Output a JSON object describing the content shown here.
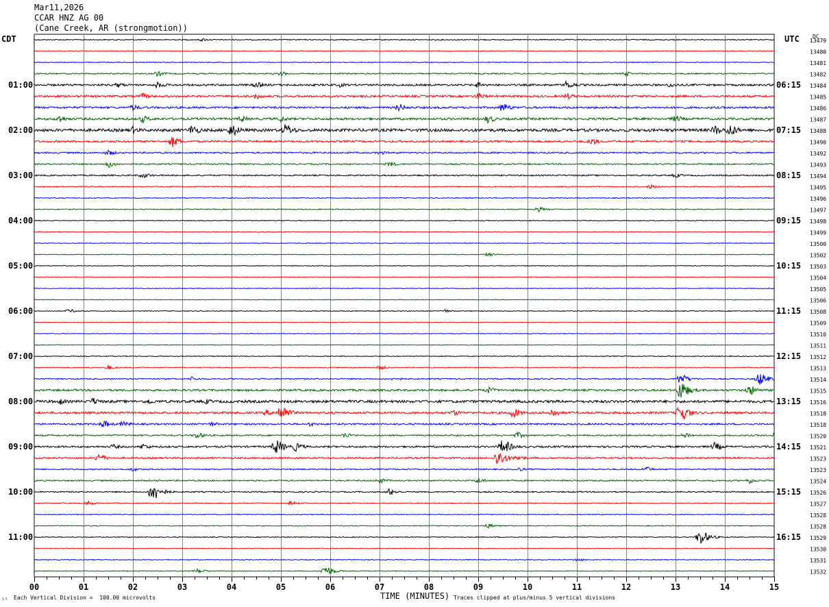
{
  "header": {
    "date": "Mar11,2026",
    "station": "CCAR HNZ AG 00",
    "location": "(Cane Creek, AR (strongmotion))"
  },
  "left_zone": "CDT",
  "right_zone": "UTC",
  "right_col_header": "DC",
  "footer": {
    "scale_note": "Each Vertical Division =  100.00 microvolts",
    "clip_note": "Traces clipped at plus/minus 5 vertical divisions",
    "corner_mark": "¹⁵"
  },
  "chart_data": {
    "type": "line",
    "title": "",
    "xlabel": "TIME (MINUTES)",
    "ylabel": "",
    "xlim": [
      0,
      15
    ],
    "x_ticks": [
      "00",
      "01",
      "02",
      "03",
      "04",
      "05",
      "06",
      "07",
      "08",
      "09",
      "10",
      "11",
      "12",
      "13",
      "14",
      "15"
    ],
    "grid": true,
    "trace_colors": [
      "#000000",
      "#ff0000",
      "#0000ff",
      "#006400"
    ],
    "left_time_labels": [
      "01:00",
      "02:00",
      "03:00",
      "04:00",
      "05:00",
      "06:00",
      "07:00",
      "08:00",
      "09:00",
      "10:00",
      "11:00"
    ],
    "right_time_labels": [
      "06:15",
      "07:15",
      "08:15",
      "09:15",
      "10:15",
      "11:15",
      "12:15",
      "13:15",
      "14:15",
      "15:15",
      "16:15"
    ],
    "right_dc_values": [
      "13479",
      "13480",
      "13481",
      "13482",
      "13484",
      "13485",
      "13486",
      "13487",
      "13488",
      "13490",
      "13492",
      "13493",
      "13494",
      "13495",
      "13496",
      "13497",
      "13498",
      "13499",
      "13500",
      "13502",
      "13503",
      "13504",
      "13505",
      "13506",
      "13508",
      "13509",
      "13510",
      "13511",
      "13512",
      "13513",
      "13514",
      "13515",
      "13516",
      "13518",
      "13518",
      "13520",
      "13521",
      "13523",
      "13523",
      "13524",
      "13526",
      "13527",
      "13528",
      "13528",
      "13529",
      "13530",
      "13531",
      "13532"
    ],
    "series": [
      {
        "row": 0,
        "noise": 0.45,
        "events": [
          [
            3.4,
            0.7
          ]
        ]
      },
      {
        "row": 1,
        "noise": 0.35,
        "events": []
      },
      {
        "row": 2,
        "noise": 0.35,
        "events": []
      },
      {
        "row": 3,
        "noise": 0.55,
        "events": [
          [
            2.5,
            1.2
          ],
          [
            5.0,
            1.0
          ],
          [
            12.0,
            1.0
          ]
        ]
      },
      {
        "row": 4,
        "noise": 0.85,
        "events": [
          [
            1.7,
            1.2
          ],
          [
            2.5,
            1.5
          ],
          [
            4.5,
            1.4
          ],
          [
            6.2,
            1.0
          ],
          [
            9.0,
            1.4
          ],
          [
            10.8,
            2.0
          ],
          [
            12.9,
            1.2
          ]
        ]
      },
      {
        "row": 5,
        "noise": 0.95,
        "events": [
          [
            2.2,
            1.4
          ],
          [
            4.5,
            1.4
          ],
          [
            9.0,
            1.6
          ],
          [
            10.8,
            1.5
          ]
        ]
      },
      {
        "row": 6,
        "noise": 0.9,
        "events": [
          [
            2.0,
            1.4
          ],
          [
            7.4,
            1.8
          ],
          [
            9.5,
            2.2
          ]
        ]
      },
      {
        "row": 7,
        "noise": 1.0,
        "events": [
          [
            0.5,
            1.9
          ],
          [
            2.2,
            1.7
          ],
          [
            4.2,
            1.5
          ],
          [
            5.0,
            1.5
          ],
          [
            9.2,
            1.8
          ],
          [
            13.0,
            1.6
          ]
        ]
      },
      {
        "row": 8,
        "noise": 1.3,
        "events": [
          [
            2.0,
            1.7
          ],
          [
            3.2,
            2.5
          ],
          [
            4.0,
            3.0
          ],
          [
            5.1,
            3.0
          ],
          [
            13.8,
            2.3
          ],
          [
            14.1,
            3.0
          ]
        ]
      },
      {
        "row": 9,
        "noise": 0.9,
        "events": [
          [
            2.8,
            2.5
          ],
          [
            11.3,
            1.6
          ]
        ]
      },
      {
        "row": 10,
        "noise": 0.7,
        "events": [
          [
            1.5,
            1.3
          ],
          [
            7.0,
            1.0
          ]
        ]
      },
      {
        "row": 11,
        "noise": 0.6,
        "events": [
          [
            1.5,
            1.6
          ],
          [
            7.2,
            1.2
          ]
        ]
      },
      {
        "row": 12,
        "noise": 0.6,
        "events": [
          [
            2.2,
            1.3
          ],
          [
            13.0,
            1.0
          ]
        ]
      },
      {
        "row": 13,
        "noise": 0.45,
        "events": [
          [
            12.5,
            1.0
          ]
        ]
      },
      {
        "row": 14,
        "noise": 0.4,
        "events": []
      },
      {
        "row": 15,
        "noise": 0.4,
        "events": [
          [
            10.2,
            1.2
          ]
        ]
      },
      {
        "row": 16,
        "noise": 0.35,
        "events": []
      },
      {
        "row": 17,
        "noise": 0.3,
        "events": []
      },
      {
        "row": 18,
        "noise": 0.3,
        "events": []
      },
      {
        "row": 19,
        "noise": 0.3,
        "events": [
          [
            9.2,
            0.8
          ]
        ]
      },
      {
        "row": 20,
        "noise": 0.3,
        "events": []
      },
      {
        "row": 21,
        "noise": 0.3,
        "events": []
      },
      {
        "row": 22,
        "noise": 0.3,
        "events": []
      },
      {
        "row": 23,
        "noise": 0.3,
        "events": []
      },
      {
        "row": 24,
        "noise": 0.35,
        "events": [
          [
            0.7,
            0.9
          ],
          [
            8.3,
            0.8
          ]
        ]
      },
      {
        "row": 25,
        "noise": 0.3,
        "events": []
      },
      {
        "row": 26,
        "noise": 0.3,
        "events": []
      },
      {
        "row": 27,
        "noise": 0.3,
        "events": []
      },
      {
        "row": 28,
        "noise": 0.35,
        "events": []
      },
      {
        "row": 29,
        "noise": 0.4,
        "events": [
          [
            1.5,
            1.0
          ],
          [
            7.0,
            1.0
          ]
        ]
      },
      {
        "row": 30,
        "noise": 0.55,
        "events": [
          [
            3.2,
            1.0
          ],
          [
            7.3,
            1.0
          ],
          [
            13.1,
            2.5
          ],
          [
            14.7,
            3.0
          ]
        ]
      },
      {
        "row": 31,
        "noise": 0.9,
        "events": [
          [
            9.2,
            1.5
          ],
          [
            13.1,
            4.5
          ],
          [
            14.5,
            2.5
          ]
        ]
      },
      {
        "row": 32,
        "noise": 1.2,
        "events": [
          [
            0.5,
            1.6
          ],
          [
            1.2,
            1.7
          ],
          [
            2.3,
            1.5
          ],
          [
            3.5,
            1.2
          ]
        ]
      },
      {
        "row": 33,
        "noise": 1.0,
        "events": [
          [
            4.7,
            1.4
          ],
          [
            5.0,
            4.0
          ],
          [
            8.5,
            1.4
          ],
          [
            9.7,
            2.5
          ],
          [
            10.5,
            2.0
          ],
          [
            13.1,
            4.5
          ]
        ]
      },
      {
        "row": 34,
        "noise": 0.75,
        "events": [
          [
            1.4,
            1.8
          ],
          [
            1.8,
            1.4
          ],
          [
            3.6,
            1.0
          ],
          [
            5.6,
            1.0
          ]
        ]
      },
      {
        "row": 35,
        "noise": 0.65,
        "events": [
          [
            3.3,
            1.5
          ],
          [
            6.3,
            1.2
          ],
          [
            9.8,
            1.4
          ],
          [
            13.2,
            1.4
          ],
          [
            15.0,
            1.0
          ]
        ]
      },
      {
        "row": 36,
        "noise": 0.8,
        "events": [
          [
            1.6,
            1.2
          ],
          [
            2.2,
            1.4
          ],
          [
            4.9,
            3.5
          ],
          [
            5.3,
            2.0
          ],
          [
            9.5,
            3.5
          ],
          [
            13.8,
            2.0
          ]
        ]
      },
      {
        "row": 37,
        "noise": 0.75,
        "events": [
          [
            1.3,
            2.0
          ],
          [
            9.4,
            4.0
          ],
          [
            9.8,
            1.4
          ]
        ]
      },
      {
        "row": 38,
        "noise": 0.55,
        "events": [
          [
            2.0,
            1.0
          ],
          [
            9.8,
            1.0
          ],
          [
            12.4,
            1.2
          ]
        ]
      },
      {
        "row": 39,
        "noise": 0.6,
        "events": [
          [
            7.0,
            1.2
          ],
          [
            9.0,
            1.2
          ],
          [
            14.5,
            1.3
          ]
        ]
      },
      {
        "row": 40,
        "noise": 0.55,
        "events": [
          [
            2.4,
            4.5
          ],
          [
            7.2,
            1.6
          ]
        ]
      },
      {
        "row": 41,
        "noise": 0.4,
        "events": [
          [
            1.1,
            1.0
          ],
          [
            5.2,
            1.0
          ]
        ]
      },
      {
        "row": 42,
        "noise": 0.35,
        "events": []
      },
      {
        "row": 43,
        "noise": 0.4,
        "events": [
          [
            9.2,
            1.0
          ]
        ]
      },
      {
        "row": 44,
        "noise": 0.35,
        "events": [
          [
            13.5,
            3.5
          ]
        ]
      },
      {
        "row": 45,
        "noise": 0.3,
        "events": []
      },
      {
        "row": 46,
        "noise": 0.35,
        "events": [
          [
            11.0,
            0.8
          ]
        ]
      },
      {
        "row": 47,
        "noise": 0.35,
        "events": [
          [
            3.3,
            1.2
          ],
          [
            5.9,
            2.5
          ]
        ]
      }
    ]
  }
}
